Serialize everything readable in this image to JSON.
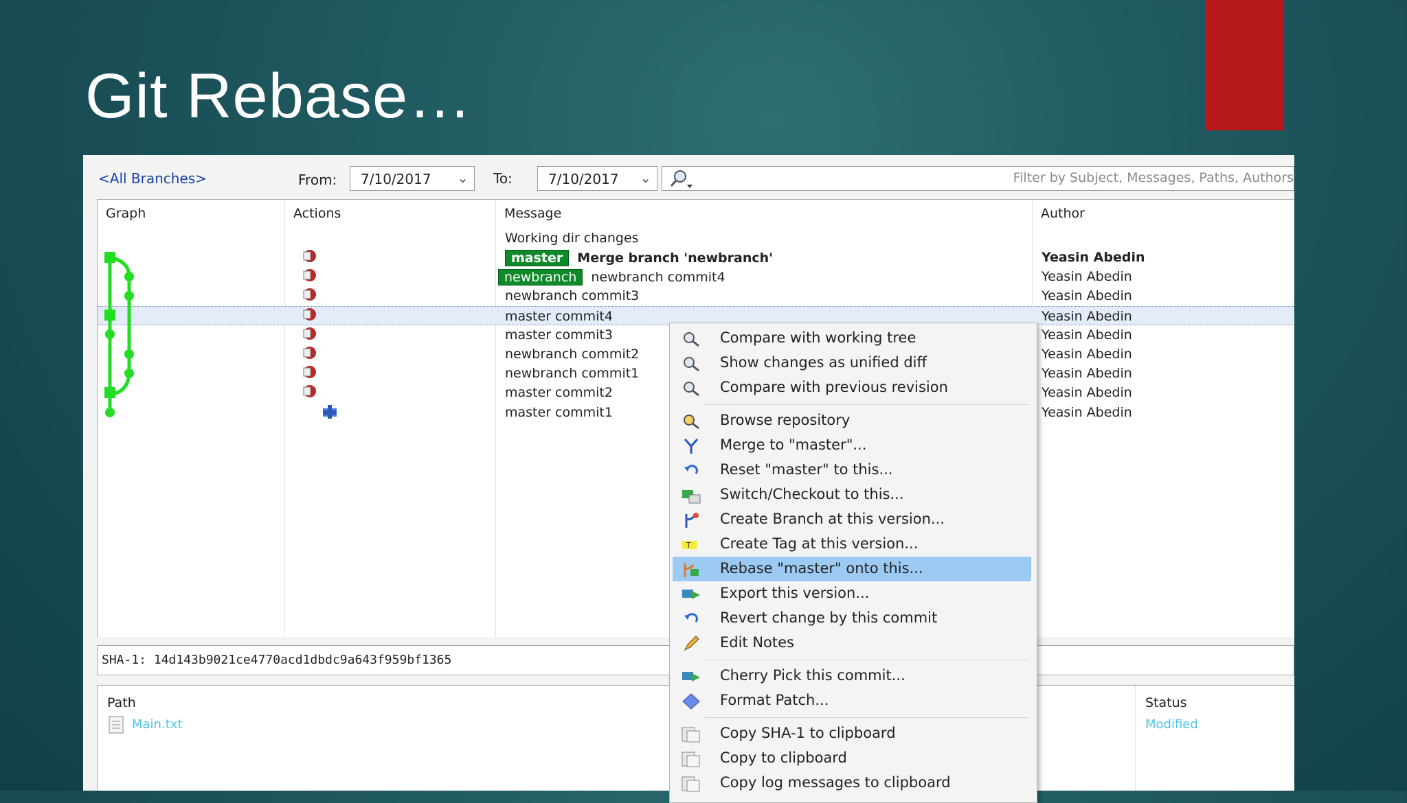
{
  "slide": {
    "title": "Git Rebase…"
  },
  "toolbar": {
    "branch_filter": "<All Branches>",
    "from_label": "From:",
    "from_date": "7/10/2017",
    "to_label": "To:",
    "to_date": "7/10/2017",
    "filter_placeholder": "Filter by Subject, Messages, Paths, Authors"
  },
  "log": {
    "columns": [
      "Graph",
      "Actions",
      "Message",
      "Author"
    ],
    "rows": [
      {
        "message": "Working dir changes",
        "author": ""
      },
      {
        "tag": "master",
        "message": "Merge branch 'newbranch'",
        "author": "Yeasin Abedin"
      },
      {
        "tag": "newbranch",
        "message": "newbranch commit4",
        "author": "Yeasin Abedin"
      },
      {
        "message": "newbranch commit3",
        "author": "Yeasin Abedin"
      },
      {
        "message": "master commit4",
        "author": "Yeasin Abedin"
      },
      {
        "message": "master commit3",
        "author": "Yeasin Abedin"
      },
      {
        "message": "newbranch commit2",
        "author": "Yeasin Abedin"
      },
      {
        "message": "newbranch commit1",
        "author": "Yeasin Abedin"
      },
      {
        "message": "master commit2",
        "author": "Yeasin Abedin"
      },
      {
        "message": "master commit1",
        "author": "Yeasin Abedin"
      }
    ],
    "selected_row": "master commit4"
  },
  "sha": "SHA-1: 14d143b9021ce4770acd1dbdc9a643f959bf1365",
  "files": {
    "path_header": "Path",
    "status_header": "Status",
    "items": [
      {
        "name": "Main.txt",
        "status": "Modified"
      }
    ]
  },
  "context_menu": {
    "items": [
      "Compare with working tree",
      "Show changes as unified diff",
      "Compare with previous revision",
      "Browse repository",
      "Merge to \"master\"...",
      "Reset \"master\" to this...",
      "Switch/Checkout to this...",
      "Create Branch at this version...",
      "Create Tag at this version...",
      "Rebase \"master\" onto this...",
      "Export this version...",
      "Revert change by this commit",
      "Edit Notes",
      "Cherry Pick this commit...",
      "Format Patch...",
      "Copy SHA-1 to clipboard",
      "Copy to clipboard",
      "Copy log messages to clipboard"
    ],
    "highlighted": "Rebase \"master\" onto this..."
  },
  "colors": {
    "accent_red": "#b5191c",
    "graph_green": "#22dd22",
    "tag_green": "#0f8a2a",
    "menu_highlight": "#9ccaf3",
    "link_cyan": "#4fc3e8"
  }
}
